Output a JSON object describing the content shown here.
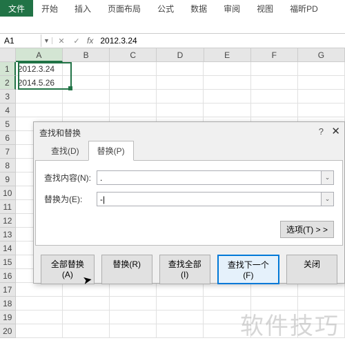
{
  "ribbon": {
    "tabs": [
      "文件",
      "开始",
      "插入",
      "页面布局",
      "公式",
      "数据",
      "审阅",
      "视图",
      "福昕PD"
    ]
  },
  "namebox": {
    "ref": "A1",
    "fx": "fx",
    "formula": "2012.3.24"
  },
  "columns": [
    "A",
    "B",
    "C",
    "D",
    "E",
    "F",
    "G"
  ],
  "rows": {
    "count": 20,
    "data": {
      "1": {
        "A": "2012.3.24"
      },
      "2": {
        "A": "2014.5.26"
      }
    }
  },
  "dialog": {
    "title": "查找和替换",
    "help": "?",
    "close": "✕",
    "tabs": {
      "find": "查找(D)",
      "replace": "替换(P)"
    },
    "fields": {
      "find_label": "查找内容(N):",
      "find_value": ".",
      "replace_label": "替换为(E):",
      "replace_value": "-|"
    },
    "options": "选项(T) > >",
    "buttons": {
      "replace_all": "全部替换(A)",
      "replace": "替换(R)",
      "find_all": "查找全部(I)",
      "find_next": "查找下一个(F)",
      "close": "关闭"
    }
  },
  "watermark": "软件技巧"
}
